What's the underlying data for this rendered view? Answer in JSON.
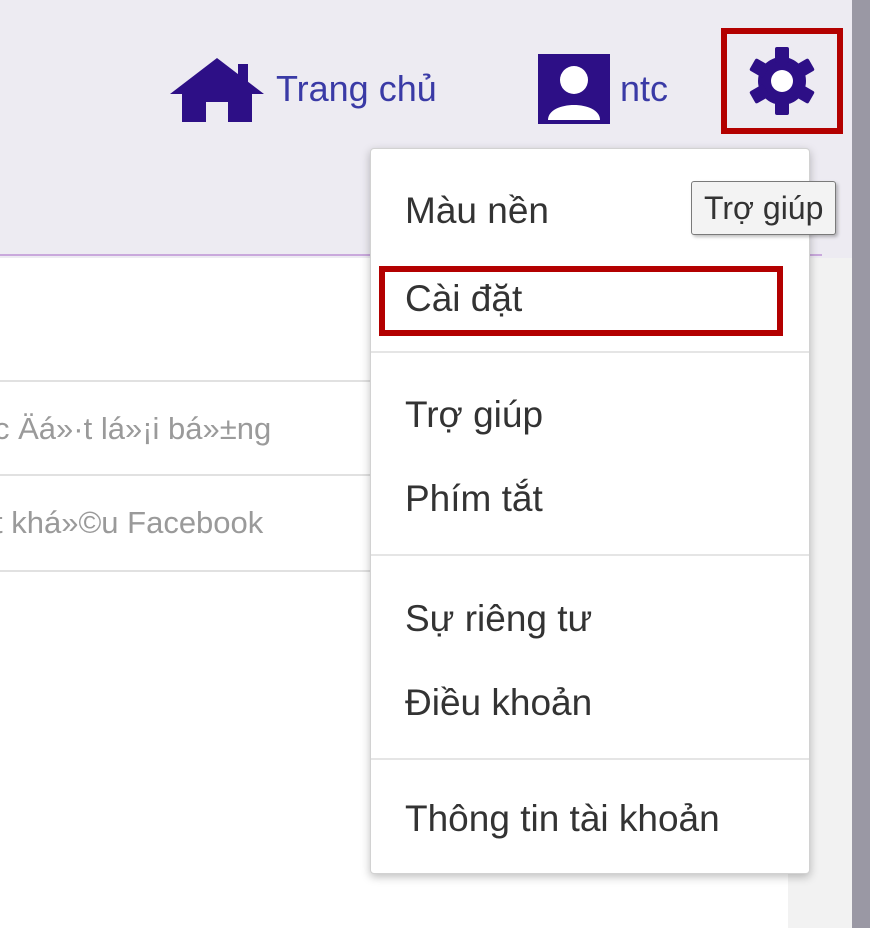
{
  "header": {
    "home_label": "Trang chủ",
    "profile_label": "ntc",
    "home_icon": "home-icon",
    "profile_icon": "user-icon",
    "settings_icon": "gear-icon"
  },
  "tooltip": {
    "text": "Trợ giúp"
  },
  "list": {
    "rows": [
      "c Äá»·t lá»¡i bá»±ng",
      "t khá»©u Facebook"
    ]
  },
  "menu": {
    "items": [
      "Màu nền",
      "Cài đặt",
      "Trợ giúp",
      "Phím tắt",
      "Sự riêng tư",
      "Điều khoản",
      "Thông tin tài khoản"
    ],
    "highlighted": "Cài đặt"
  },
  "colors": {
    "link": "#3a3aa6",
    "icon": "#2d0f86",
    "highlight_border": "#b30000",
    "header_bg": "#edebf2"
  }
}
